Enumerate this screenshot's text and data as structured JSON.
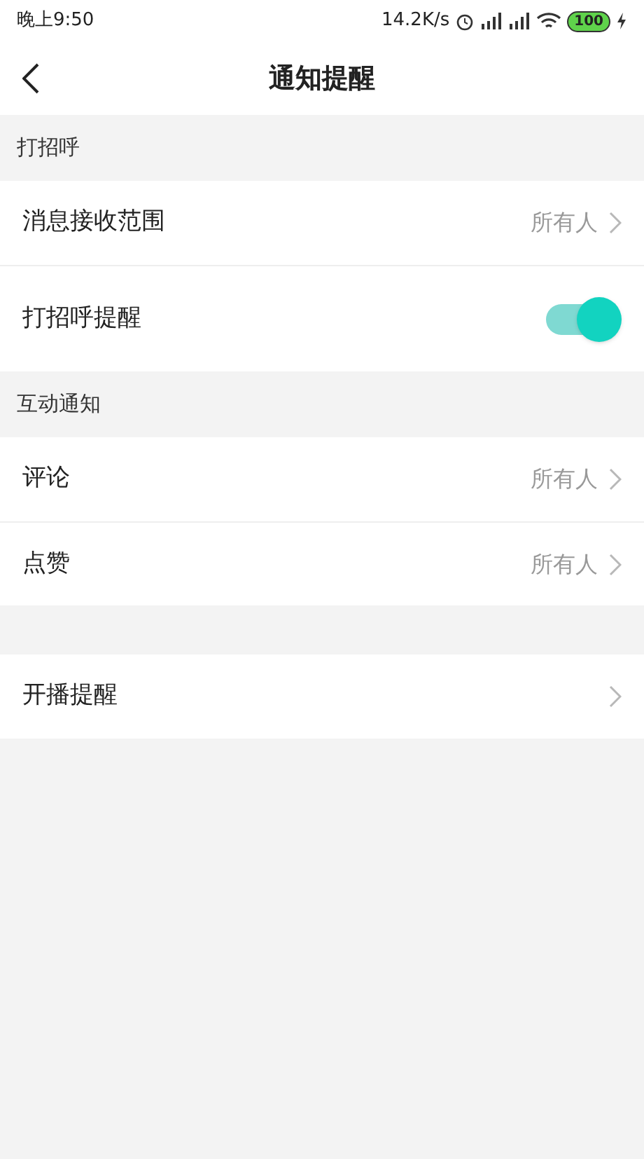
{
  "status_bar": {
    "time": "晚上9:50",
    "speed": "14.2K/s",
    "battery": "100"
  },
  "title": "通知提醒",
  "sections": [
    {
      "header": "打招呼",
      "items": [
        {
          "kind": "link",
          "label": "消息接收范围",
          "value": "所有人"
        },
        {
          "kind": "toggle",
          "label": "打招呼提醒",
          "on": true
        }
      ]
    },
    {
      "header": "互动通知",
      "items": [
        {
          "kind": "link",
          "label": "评论",
          "value": "所有人"
        },
        {
          "kind": "link",
          "label": "点赞",
          "value": "所有人"
        }
      ]
    },
    {
      "items": [
        {
          "kind": "link",
          "label": "开播提醒"
        }
      ]
    }
  ]
}
